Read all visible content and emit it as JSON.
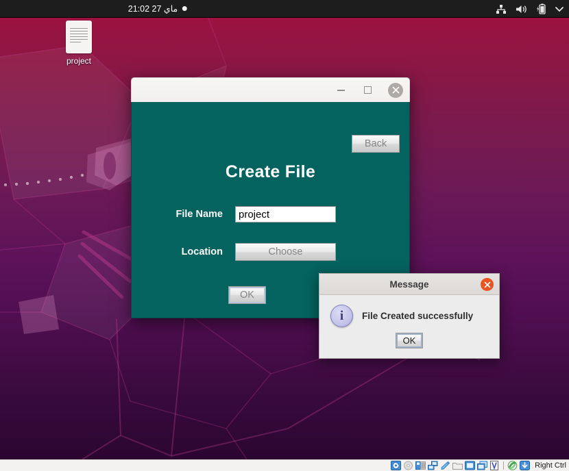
{
  "top_panel": {
    "clock": "ماي 27  21:02",
    "record_indicator": "record-dot",
    "tray": [
      {
        "name": "network-icon",
        "glyph": "network"
      },
      {
        "name": "volume-icon",
        "glyph": "volume"
      },
      {
        "name": "battery-charging-icon",
        "glyph": "battery"
      },
      {
        "name": "chevron-down-icon",
        "glyph": "chevron"
      }
    ]
  },
  "desktop": {
    "icon": {
      "label": "project",
      "type": "document-file-icon"
    }
  },
  "app_window": {
    "titlebar": {
      "title": "",
      "minimize_label": "−",
      "maximize_label": "□",
      "close_label": "✕"
    },
    "back_button": "Back",
    "heading": "Create File",
    "fields": [
      {
        "label": "File Name",
        "value": "project",
        "placeholder": ""
      },
      {
        "label": "Location",
        "button": "Choose"
      }
    ],
    "ok_button": "OK",
    "accent_bg": "#04625f"
  },
  "message_dialog": {
    "title": "Message",
    "close_label": "✕",
    "icon": "info-icon",
    "icon_glyph": "i",
    "text": "File Created successfully",
    "ok_button": "OK",
    "close_color": "#e95420"
  },
  "vbox_statusbar": {
    "host_key": "Right Ctrl",
    "icons": [
      "hard-disk-icon",
      "optical-disk-icon",
      "floppy-disk-icon",
      "network-adapter-icon",
      "usb-icon",
      "shared-folders-icon",
      "display-icon",
      "video-capture-icon",
      "virtualbox-logo-icon",
      "mouse-integration-icon",
      "host-key-icon"
    ]
  }
}
